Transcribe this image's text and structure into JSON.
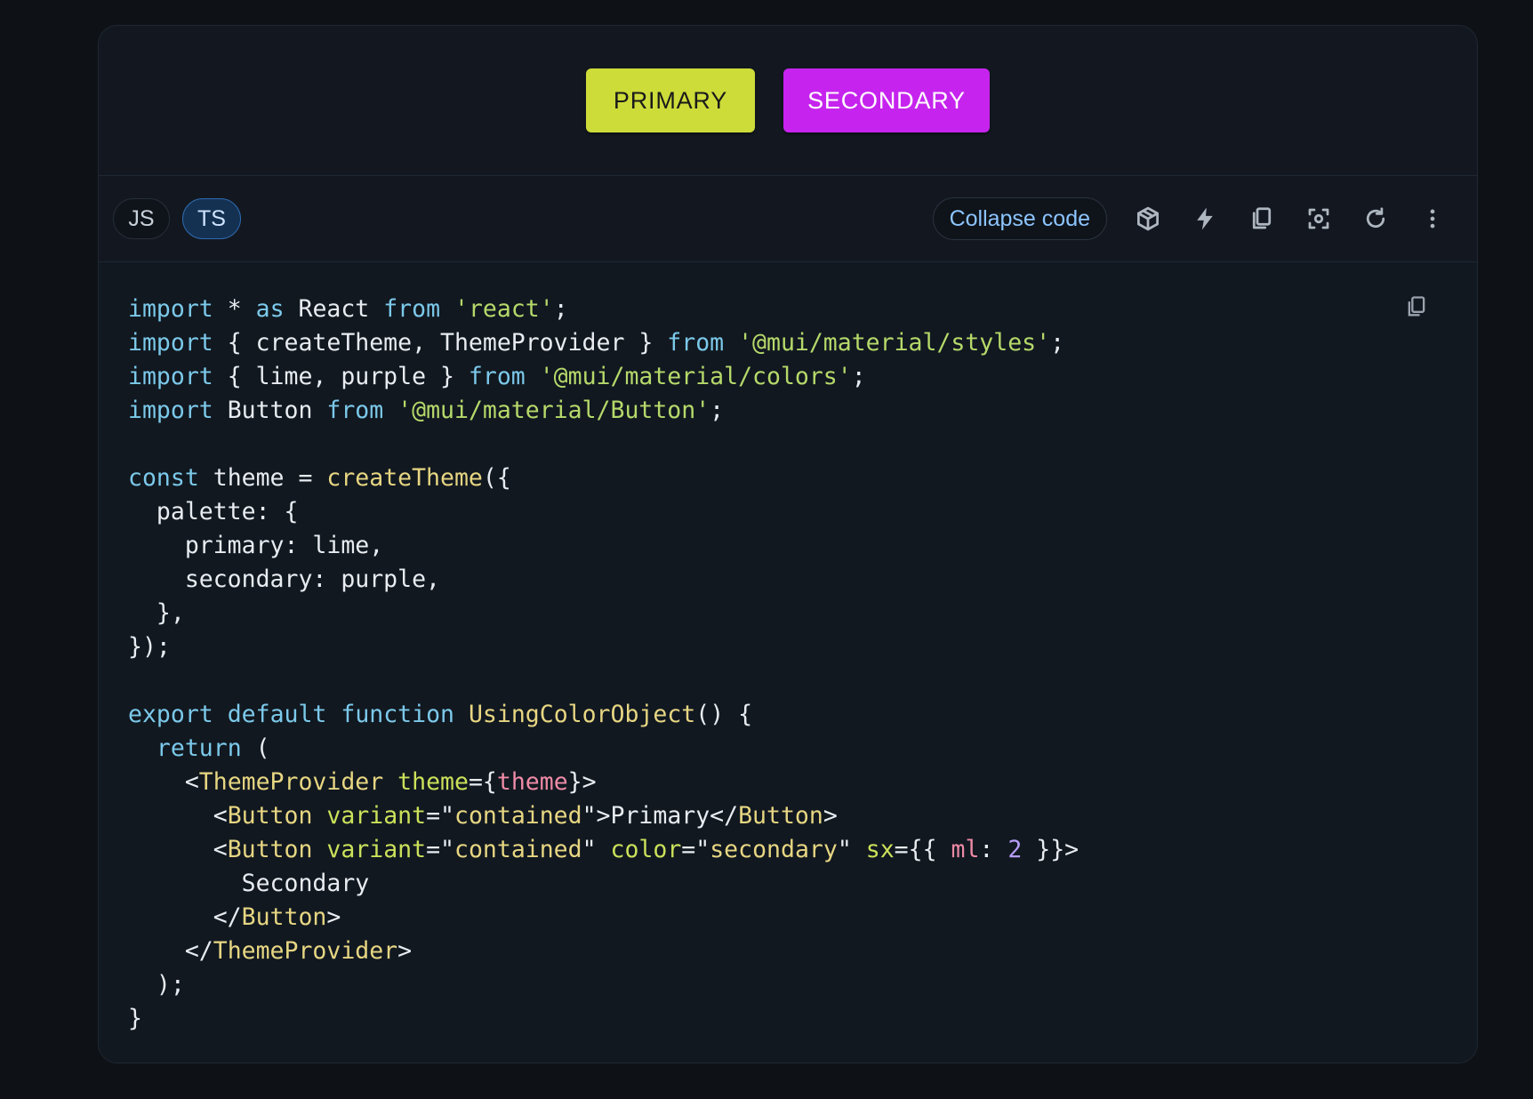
{
  "preview": {
    "primary_label": "Primary",
    "secondary_label": "Secondary",
    "colors": {
      "primary": "#cddc39",
      "secondary": "#c624ee"
    }
  },
  "toolbar": {
    "lang_js": "JS",
    "lang_ts": "TS",
    "active_lang": "TS",
    "collapse_label": "Collapse code",
    "icons": [
      "codesandbox-icon",
      "stackblitz-bolt-icon",
      "copy-icon",
      "reset-focus-icon",
      "refresh-icon",
      "more-vert-icon"
    ]
  },
  "code": {
    "lines": [
      [
        [
          "kw",
          "import"
        ],
        [
          "pl",
          " * "
        ],
        [
          "kw",
          "as"
        ],
        [
          "pl",
          " React "
        ],
        [
          "kw",
          "from"
        ],
        [
          "pl",
          " "
        ],
        [
          "str",
          "'react'"
        ],
        [
          "pl",
          ";"
        ]
      ],
      [
        [
          "kw",
          "import"
        ],
        [
          "pl",
          " { createTheme, ThemeProvider } "
        ],
        [
          "kw",
          "from"
        ],
        [
          "pl",
          " "
        ],
        [
          "str",
          "'@mui/material/styles'"
        ],
        [
          "pl",
          ";"
        ]
      ],
      [
        [
          "kw",
          "import"
        ],
        [
          "pl",
          " { lime, purple } "
        ],
        [
          "kw",
          "from"
        ],
        [
          "pl",
          " "
        ],
        [
          "str",
          "'@mui/material/colors'"
        ],
        [
          "pl",
          ";"
        ]
      ],
      [
        [
          "kw",
          "import"
        ],
        [
          "pl",
          " Button "
        ],
        [
          "kw",
          "from"
        ],
        [
          "pl",
          " "
        ],
        [
          "str",
          "'@mui/material/Button'"
        ],
        [
          "pl",
          ";"
        ]
      ],
      [],
      [
        [
          "kw",
          "const"
        ],
        [
          "pl",
          " theme = "
        ],
        [
          "fn",
          "createTheme"
        ],
        [
          "pl",
          "({"
        ]
      ],
      [
        [
          "pl",
          "  palette: {"
        ]
      ],
      [
        [
          "pl",
          "    primary: lime,"
        ]
      ],
      [
        [
          "pl",
          "    secondary: purple,"
        ]
      ],
      [
        [
          "pl",
          "  },"
        ]
      ],
      [
        [
          "pl",
          "});"
        ]
      ],
      [],
      [
        [
          "kw",
          "export"
        ],
        [
          "pl",
          " "
        ],
        [
          "kw",
          "default"
        ],
        [
          "pl",
          " "
        ],
        [
          "kw",
          "function"
        ],
        [
          "pl",
          " "
        ],
        [
          "fn",
          "UsingColorObject"
        ],
        [
          "pl",
          "() {"
        ]
      ],
      [
        [
          "pl",
          "  "
        ],
        [
          "kw",
          "return"
        ],
        [
          "pl",
          " ("
        ]
      ],
      [
        [
          "pl",
          "    <"
        ],
        [
          "tag",
          "ThemeProvider"
        ],
        [
          "pl",
          " "
        ],
        [
          "attr",
          "theme"
        ],
        [
          "pl",
          "={"
        ],
        [
          "var",
          "theme"
        ],
        [
          "pl",
          "}>"
        ]
      ],
      [
        [
          "pl",
          "      <"
        ],
        [
          "tag",
          "Button"
        ],
        [
          "pl",
          " "
        ],
        [
          "attr",
          "variant"
        ],
        [
          "pl",
          "=\""
        ],
        [
          "fn",
          "contained"
        ],
        [
          "pl",
          "\">Primary</"
        ],
        [
          "tag",
          "Button"
        ],
        [
          "pl",
          ">"
        ]
      ],
      [
        [
          "pl",
          "      <"
        ],
        [
          "tag",
          "Button"
        ],
        [
          "pl",
          " "
        ],
        [
          "attr",
          "variant"
        ],
        [
          "pl",
          "=\""
        ],
        [
          "fn",
          "contained"
        ],
        [
          "pl",
          "\" "
        ],
        [
          "attr",
          "color"
        ],
        [
          "pl",
          "=\""
        ],
        [
          "fn",
          "secondary"
        ],
        [
          "pl",
          "\" "
        ],
        [
          "attr",
          "sx"
        ],
        [
          "pl",
          "={{ "
        ],
        [
          "var",
          "ml"
        ],
        [
          "pl",
          ": "
        ],
        [
          "num",
          "2"
        ],
        [
          "pl",
          " }}>"
        ]
      ],
      [
        [
          "pl",
          "        Secondary"
        ]
      ],
      [
        [
          "pl",
          "      </"
        ],
        [
          "tag",
          "Button"
        ],
        [
          "pl",
          ">"
        ]
      ],
      [
        [
          "pl",
          "    </"
        ],
        [
          "tag",
          "ThemeProvider"
        ],
        [
          "pl",
          ">"
        ]
      ],
      [
        [
          "pl",
          "  );"
        ]
      ],
      [
        [
          "pl",
          "}"
        ]
      ]
    ]
  }
}
